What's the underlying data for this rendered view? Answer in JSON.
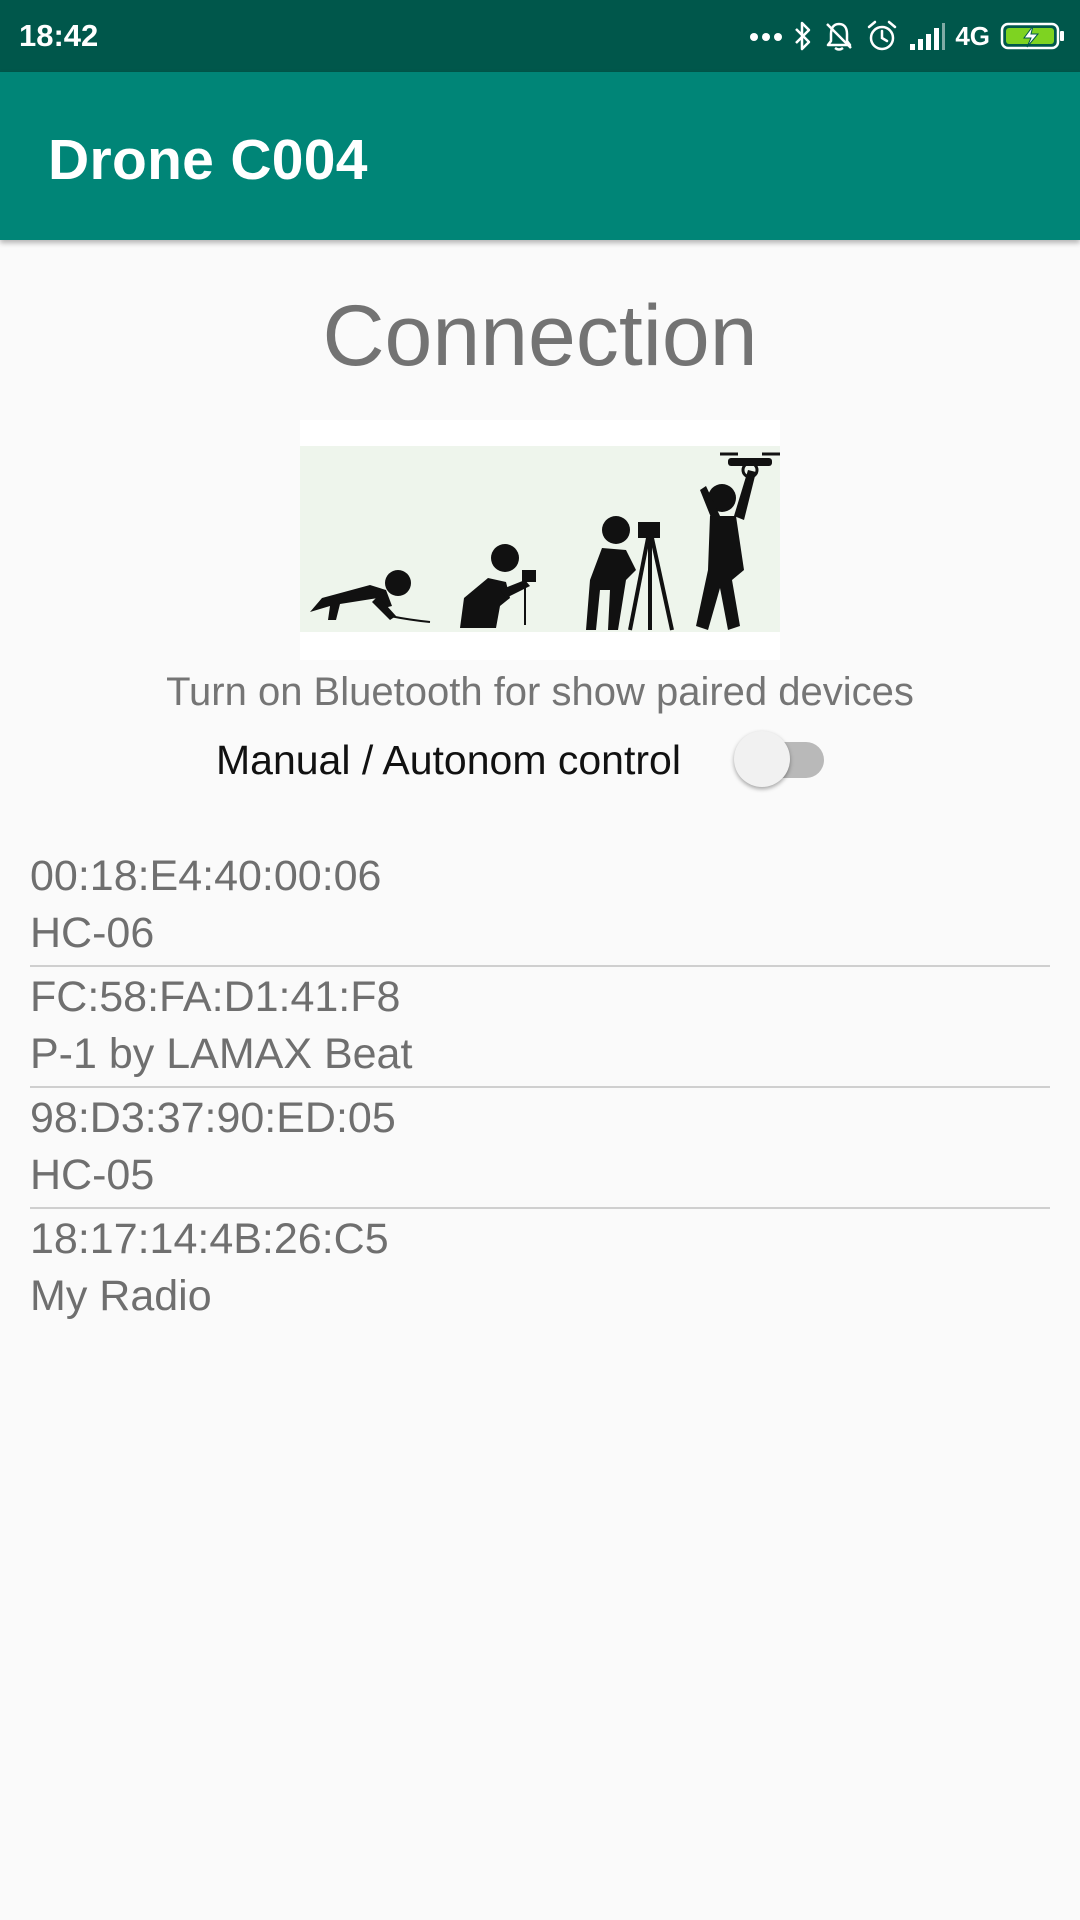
{
  "status_bar": {
    "time": "18:42",
    "network": "4G",
    "icons": [
      "more-dots-icon",
      "bluetooth-icon",
      "notifications-off-icon",
      "alarm-icon",
      "signal-icon",
      "battery-charging-icon"
    ]
  },
  "app_bar": {
    "title": "Drone C004"
  },
  "main": {
    "heading": "Connection",
    "illustration": "drone-evolution-image",
    "hint": "Turn on Bluetooth for show paired devices",
    "control_switch": {
      "label": "Manual / Autonom control",
      "checked": false
    }
  },
  "devices": [
    {
      "address": "00:18:E4:40:00:06",
      "name": "HC-06"
    },
    {
      "address": "FC:58:FA:D1:41:F8",
      "name": "P-1 by LAMAX Beat"
    },
    {
      "address": "98:D3:37:90:ED:05",
      "name": "HC-05"
    },
    {
      "address": "18:17:14:4B:26:C5",
      "name": "My Radio"
    }
  ],
  "colors": {
    "status_bar": "#00574b",
    "app_bar": "#008577",
    "background": "#fafafa"
  }
}
